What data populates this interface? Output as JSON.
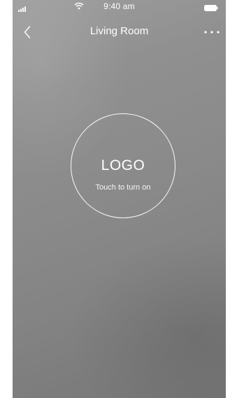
{
  "status_bar": {
    "time": "9:40 am",
    "icons": [
      "signal-icon",
      "wifi-icon",
      "battery-icon"
    ]
  },
  "nav": {
    "back_icon": "chevron-left-icon",
    "title": "Living Room",
    "more_icon": "more-horizontal-icon"
  },
  "power": {
    "logo": "LOGO",
    "hint": "Touch to turn on"
  },
  "colors": {
    "foreground": "#ffffff",
    "background_top": "#9e9e9e",
    "background_bottom": "#767676"
  }
}
